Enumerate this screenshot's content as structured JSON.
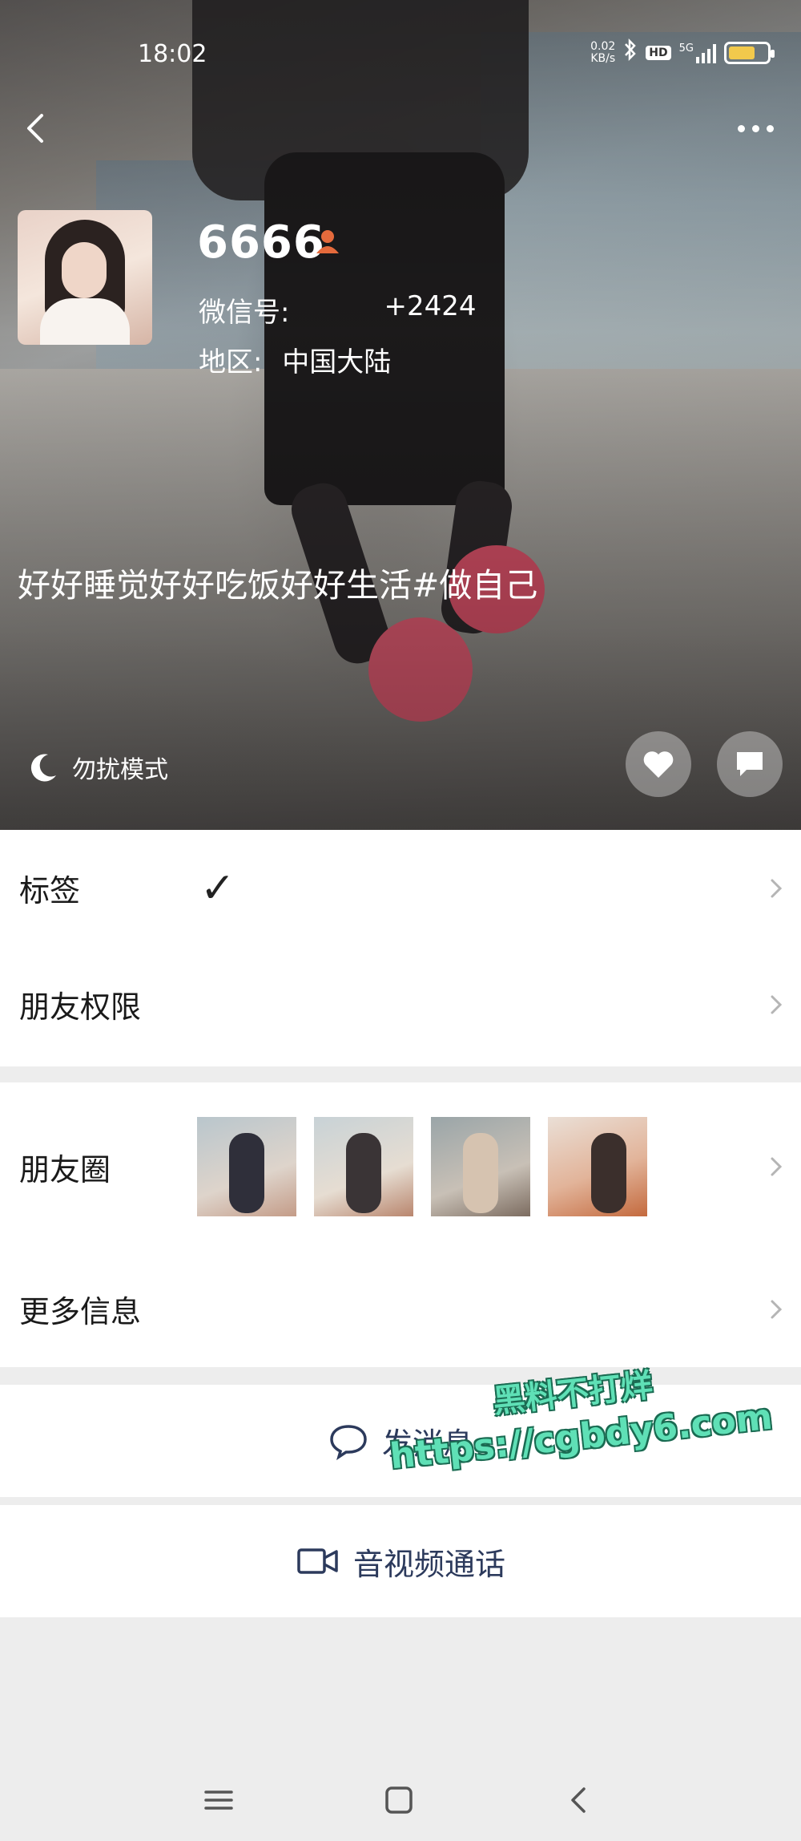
{
  "status_bar": {
    "time": "18:02",
    "net_speed_value": "0.02",
    "net_speed_unit": "KB/s",
    "hd": "HD",
    "network": "5G",
    "icons": [
      "bluetooth-icon",
      "hd-icon",
      "signal-icon",
      "battery-icon"
    ],
    "battery_color": "#f2c94c"
  },
  "profile": {
    "nickname": "6666",
    "wechat_id_label": "微信号:",
    "wechat_id_suffix": "+2424",
    "region_label": "地区:",
    "region_value": "中国大陆",
    "signature": "好好睡觉好好吃饭好好生活#做自己",
    "dnd_label": "勿扰模式"
  },
  "menu": {
    "tags_label": "标签",
    "tags_mark": "✓",
    "permissions_label": "朋友权限",
    "moments_label": "朋友圈",
    "more_info_label": "更多信息"
  },
  "actions": {
    "send_message": "发消息",
    "av_call": "音视频通话"
  },
  "watermark": {
    "line1": "黑料不打烊",
    "line2": "https://cgbdy6.com",
    "color": "#5fe0b6"
  },
  "colors": {
    "action_text": "#2c3a5c",
    "page_bg": "#ededed",
    "section_bg": "#ffffff"
  }
}
